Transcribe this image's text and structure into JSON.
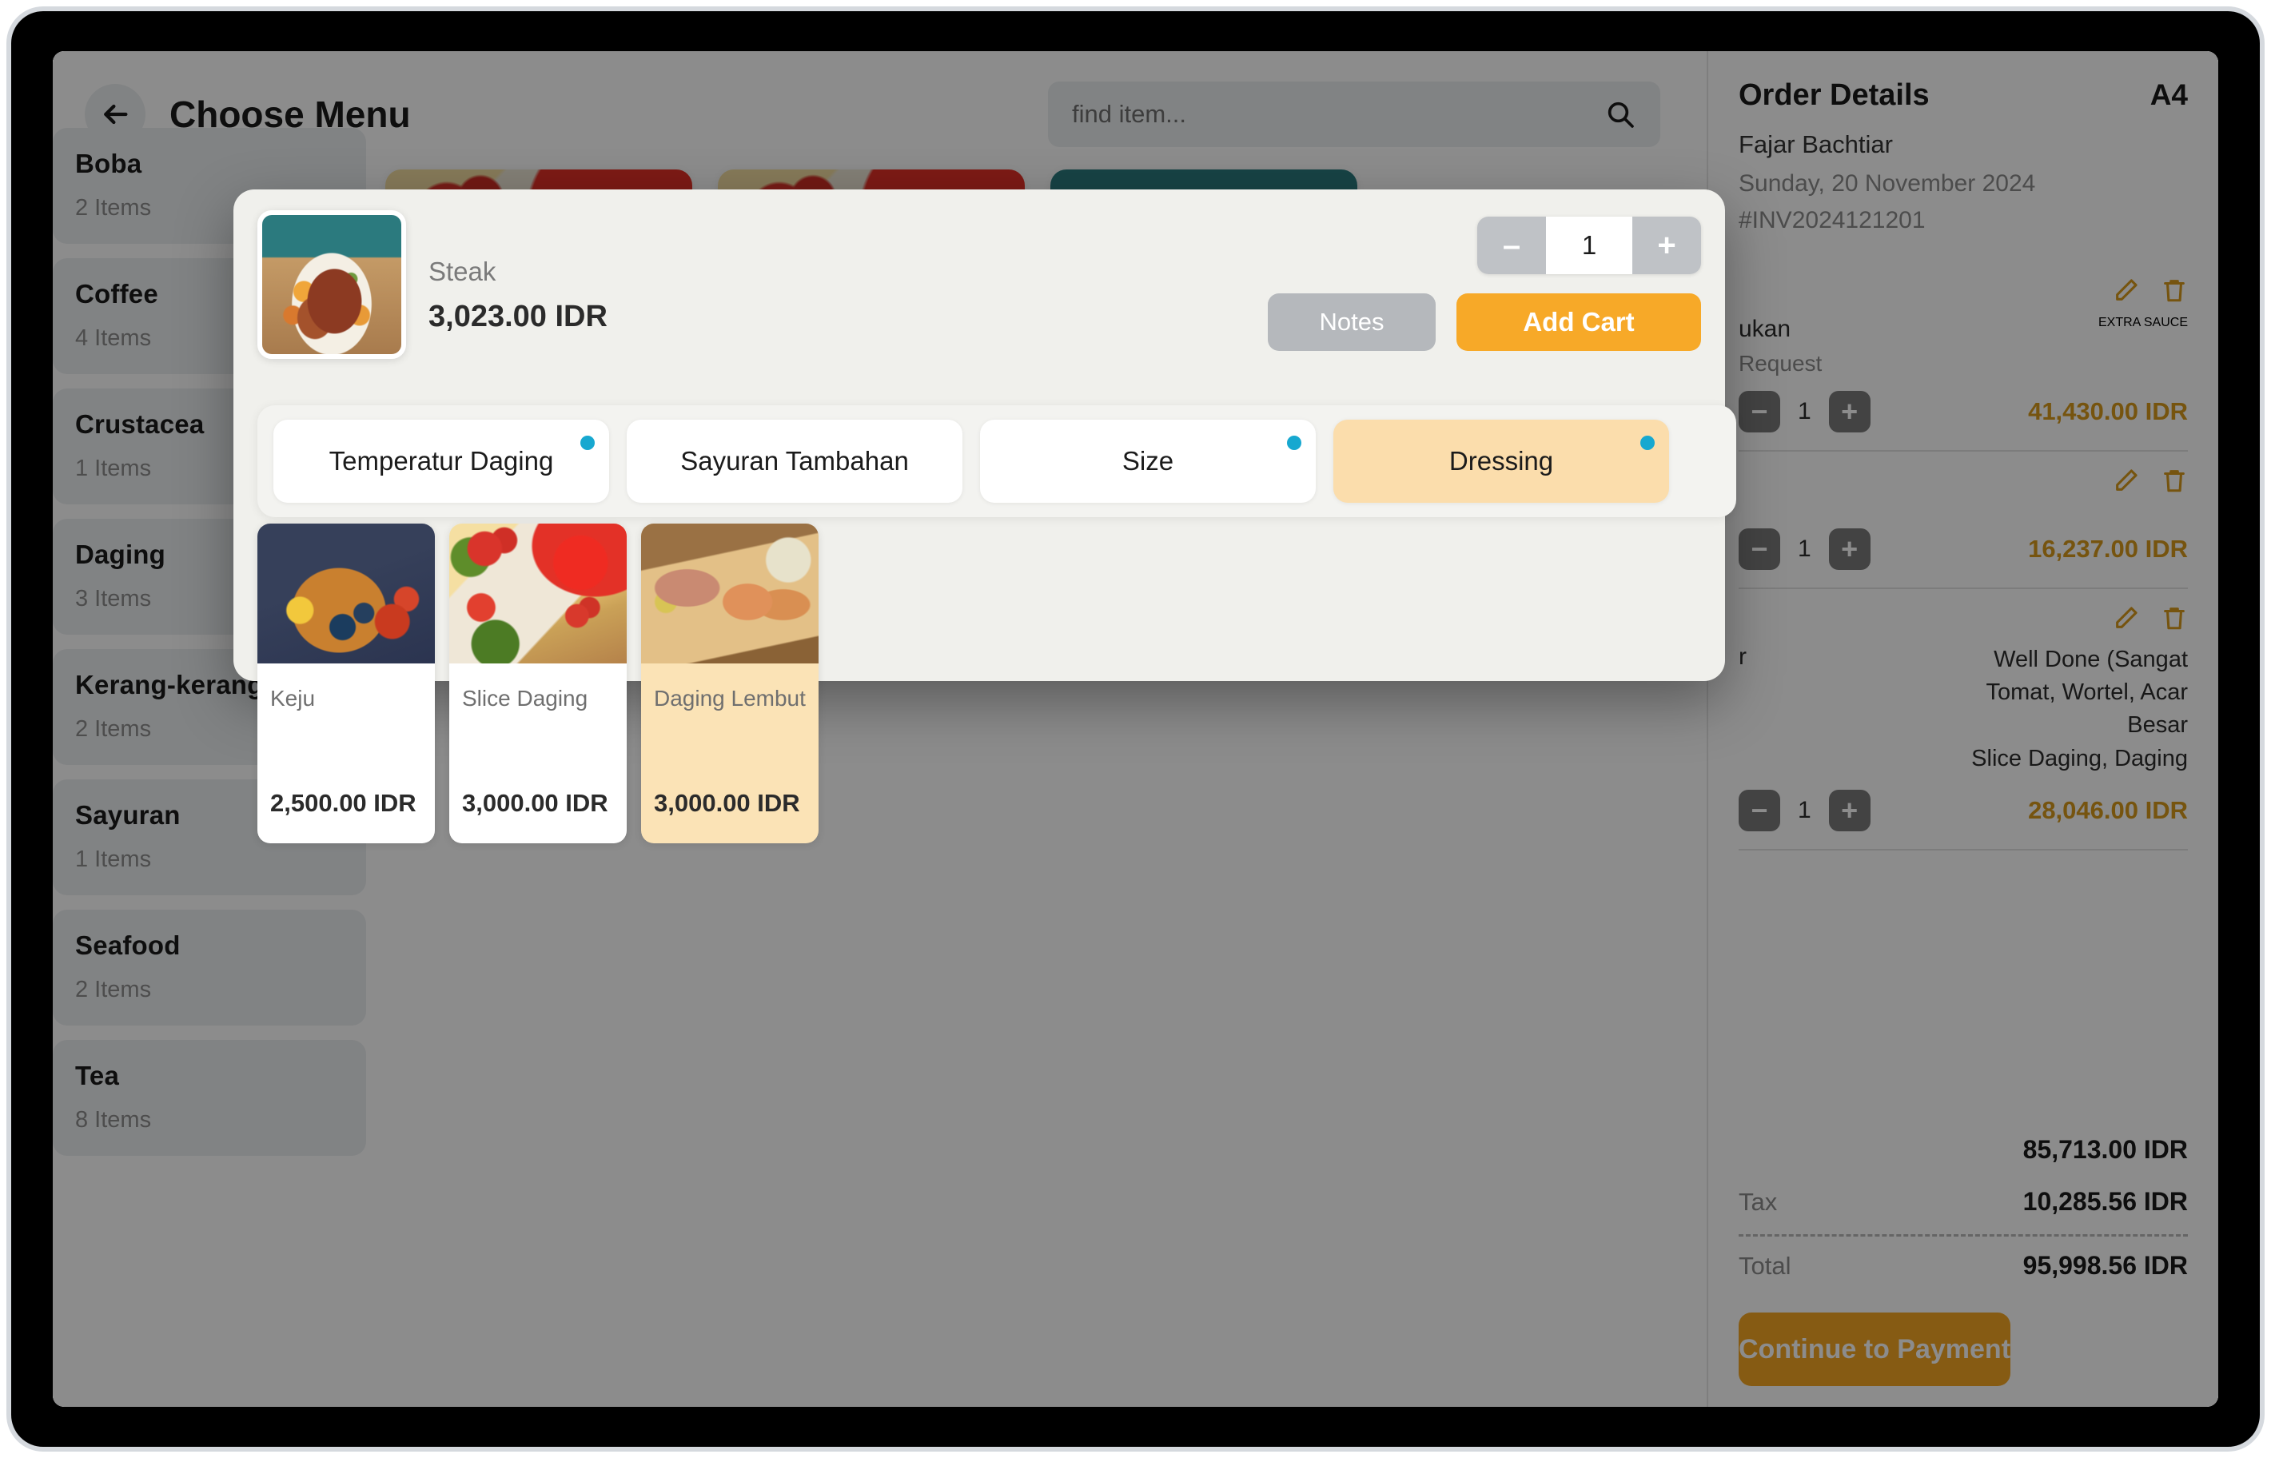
{
  "header": {
    "title": "Choose Menu",
    "back_icon": "arrow-left-icon",
    "search": {
      "placeholder": "find item...",
      "value": "",
      "icon": "search-icon"
    }
  },
  "categories": [
    {
      "name": "Boba",
      "count": "2 Items"
    },
    {
      "name": "Coffee",
      "count": "4 Items"
    },
    {
      "name": "Crustacea",
      "count": "1 Items"
    },
    {
      "name": "Daging",
      "count": "3 Items"
    },
    {
      "name": "Kerang-kerangan",
      "count": "2 Items"
    },
    {
      "name": "Sayuran",
      "count": "1 Items"
    },
    {
      "name": "Seafood",
      "count": "2 Items"
    },
    {
      "name": "Tea",
      "count": "8 Items"
    }
  ],
  "product_grid": [
    {
      "image": "food-wrap"
    },
    {
      "image": "food-wrap"
    },
    {
      "image": "food-steak"
    }
  ],
  "modal": {
    "item_name": "Steak",
    "item_price": "3,023.00 IDR",
    "quantity": "1",
    "decrease_label": "–",
    "increase_label": "+",
    "notes_label": "Notes",
    "add_cart_label": "Add Cart",
    "option_tabs": [
      {
        "label": "Temperatur Daging",
        "active": false,
        "has_dot": true
      },
      {
        "label": "Sayuran Tambahan",
        "active": false,
        "has_dot": false
      },
      {
        "label": "Size",
        "active": false,
        "has_dot": true
      },
      {
        "label": "Dressing",
        "active": true,
        "has_dot": true
      }
    ],
    "options": [
      {
        "name": "Keju",
        "price": "2,500.00 IDR",
        "selected": false,
        "image": "food-seafood"
      },
      {
        "name": "Slice Daging",
        "price": "3,000.00 IDR",
        "selected": false,
        "image": "food-wrap"
      },
      {
        "name": "Daging Lembut",
        "price": "3,000.00 IDR",
        "selected": true,
        "image": "food-board"
      }
    ]
  },
  "order_panel": {
    "title": "Order Details",
    "table_badge": "A4",
    "customer": "Fajar Bachtiar",
    "date": "Sunday, 20 November 2024",
    "invoice": "#INV2024121201",
    "edit_icon": "pencil-icon",
    "delete_icon": "trash-icon",
    "items": [
      {
        "name": "ukan",
        "note": "Request",
        "options": "EXTRA SAUCE",
        "qty": "1",
        "price": "41,430.00 IDR"
      },
      {
        "name": "",
        "note": "",
        "options": "",
        "qty": "1",
        "price": "16,237.00 IDR"
      },
      {
        "name": "r",
        "note": "",
        "options": "Well Done (Sangat\nTomat, Wortel, Acar\nBesar\nSlice Daging, Daging",
        "qty": "1",
        "price": "28,046.00 IDR"
      }
    ],
    "totals": [
      {
        "label": "",
        "value": "85,713.00 IDR"
      },
      {
        "label": "Tax",
        "value": "10,285.56 IDR"
      },
      {
        "label": "Total",
        "value": "95,998.56 IDR"
      }
    ],
    "continue_label": "Continue to Payment"
  },
  "colors": {
    "accent_orange": "#f5a623",
    "add_cart_orange": "#f7a928",
    "selected_amber": "#fbe3b6",
    "tab_dot_blue": "#17a8d0",
    "price_gold": "#d79a1c"
  }
}
